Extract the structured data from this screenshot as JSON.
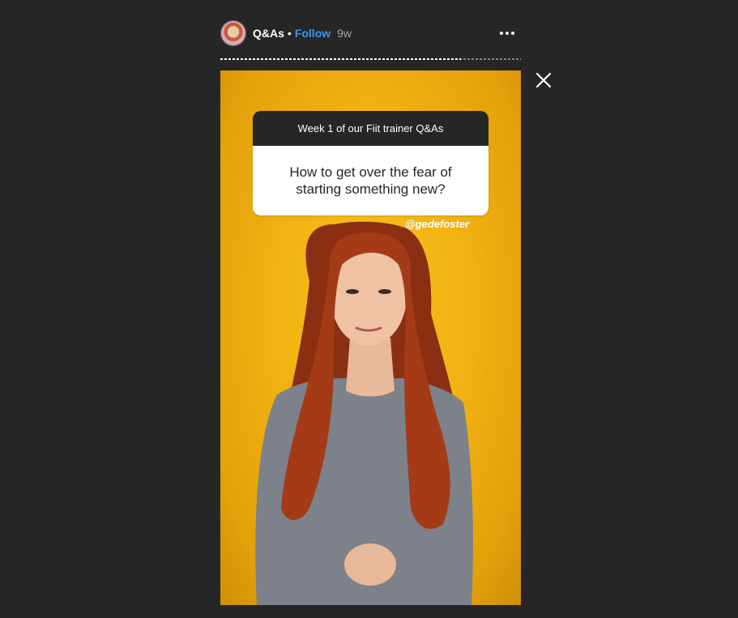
{
  "header": {
    "username": "Q&As",
    "separator": "•",
    "follow_label": "Follow",
    "time": "9w"
  },
  "progress": {
    "fraction": 0.8
  },
  "question_card": {
    "title": "Week 1 of our Fiit trainer Q&As",
    "question": "How to get over the fear of starting something new?"
  },
  "mention": "@gedefoster",
  "icons": {
    "more": "more-options-icon",
    "close": "close-icon"
  },
  "colors": {
    "background": "#262626",
    "follow": "#3897f0",
    "story_bg": "#f1b212"
  }
}
